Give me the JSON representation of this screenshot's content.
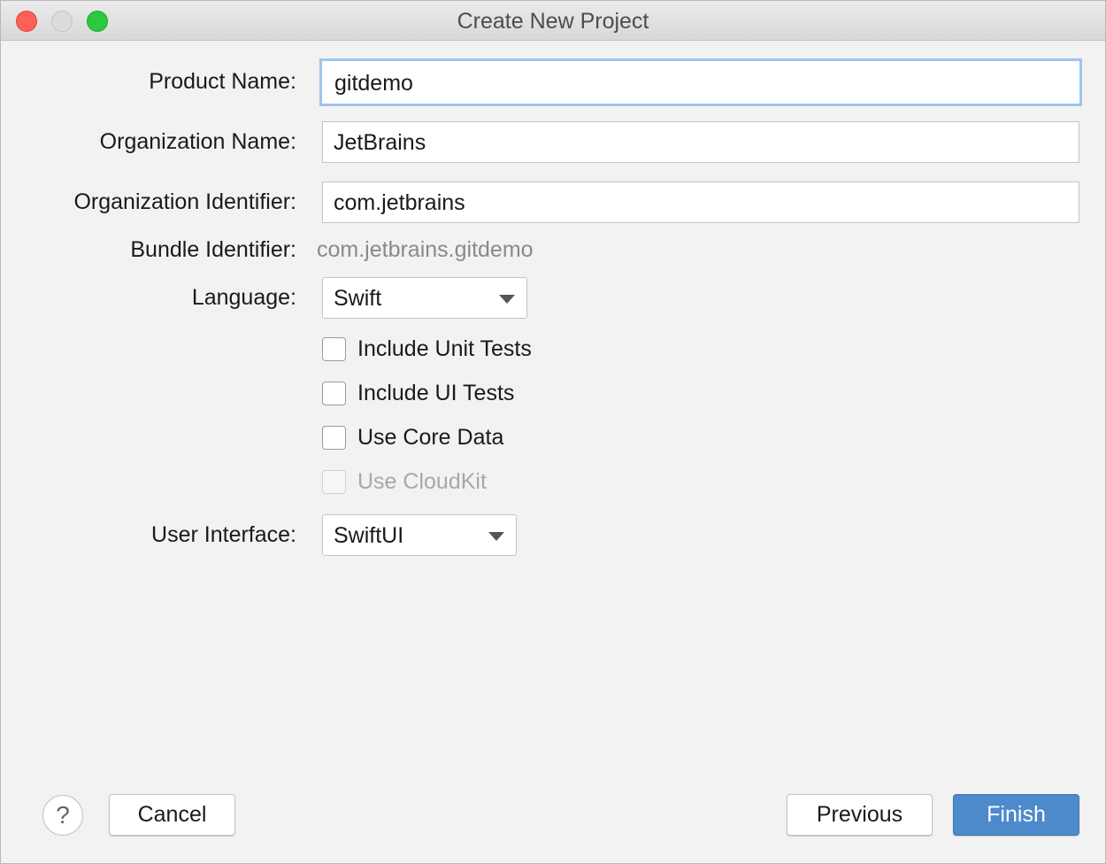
{
  "window": {
    "title": "Create New Project"
  },
  "form": {
    "product_name": {
      "label": "Product Name:",
      "value": "gitdemo"
    },
    "organization_name": {
      "label": "Organization Name:",
      "value": "JetBrains"
    },
    "organization_identifier": {
      "label": "Organization Identifier:",
      "value": "com.jetbrains"
    },
    "bundle_identifier": {
      "label": "Bundle Identifier:",
      "value": "com.jetbrains.gitdemo"
    },
    "language": {
      "label": "Language:",
      "value": "Swift"
    },
    "checkboxes": [
      {
        "label": "Include Unit Tests",
        "checked": false,
        "enabled": true
      },
      {
        "label": "Include UI Tests",
        "checked": false,
        "enabled": true
      },
      {
        "label": "Use Core Data",
        "checked": false,
        "enabled": true
      },
      {
        "label": "Use CloudKit",
        "checked": false,
        "enabled": false
      }
    ],
    "user_interface": {
      "label": "User Interface:",
      "value": "SwiftUI"
    }
  },
  "footer": {
    "help": "?",
    "cancel": "Cancel",
    "previous": "Previous",
    "finish": "Finish"
  },
  "colors": {
    "accent": "#4d8acb",
    "focus_ring": "#9fc4ec"
  }
}
